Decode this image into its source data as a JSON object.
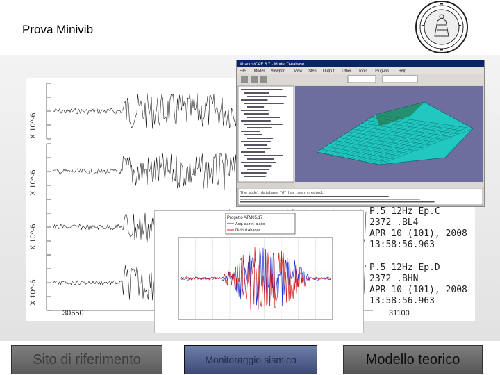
{
  "slide": {
    "title": "Prova Minivib"
  },
  "seismograms": {
    "y_axis_label": "X 10^-6",
    "x_tick_left": "30650",
    "x_tick_right": "31100",
    "trace_labels": [
      {
        "line1": "P.5 12Hz Ep.C",
        "line2": "2372 .BL4",
        "line3": "APR 10 (101), 2008",
        "line4": "13:58:56.963"
      },
      {
        "line1": "P.5 12Hz Ep.D",
        "line2": "2372 .BHN",
        "line3": "APR 10 (101), 2008",
        "line4": "13:58:56.963"
      }
    ]
  },
  "spectrum_chart": {
    "legend_title": "Progetto ATM05.17",
    "legend_items": [
      "Acq. ac.ref. a.sito",
      "Output Abaqus"
    ],
    "series_colors": {
      "blue": "#1f2fd0",
      "red": "#d01f1f"
    }
  },
  "fem_window": {
    "title": "Abaqus/CAE 6.7 - Model Database",
    "menu_items": [
      "File",
      "Model",
      "Viewport",
      "View",
      "Step",
      "Output",
      "Other",
      "Tools",
      "Plug-ins",
      "Help"
    ],
    "console_text": "The model database \"d\" has been created."
  },
  "navigation": {
    "site_label": "Sito di riferimento",
    "monitoring_label": "Monitoraggio sismico",
    "model_label": "Modello teorico"
  },
  "colors": {
    "trace": "#222222",
    "mesh_fill": "#20c8c0",
    "mesh_line": "#0a5a55",
    "fem_bg": "#6e6e9e"
  }
}
